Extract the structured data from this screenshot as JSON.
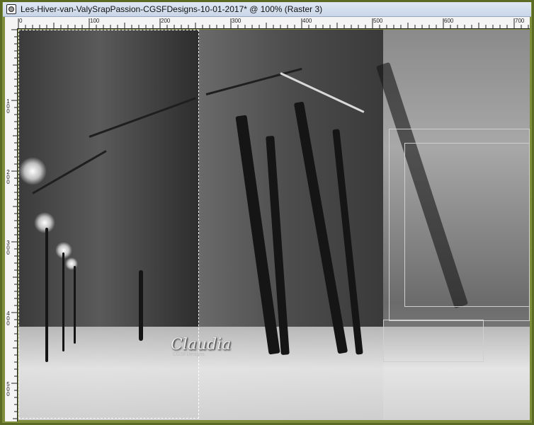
{
  "window": {
    "title": "Les-Hiver-van-ValySrapPassion-CGSFDesigns-10-01-2017* @ 100% (Raster 3)",
    "icon": "image-window-icon"
  },
  "ruler_top": {
    "labels": [
      "0",
      "100",
      "200",
      "300",
      "400",
      "500",
      "600",
      "700"
    ]
  },
  "ruler_left": {
    "labels": [
      "1\n0\n0",
      "2\n0\n0",
      "3\n0\n0",
      "4\n0\n0",
      "5\n0\n0"
    ]
  },
  "canvas": {
    "signature": "Claudia",
    "signature_sub": "CGSFDesigns"
  },
  "colors": {
    "frame": "#6f7f2f",
    "titlebar": "#d3deec"
  }
}
